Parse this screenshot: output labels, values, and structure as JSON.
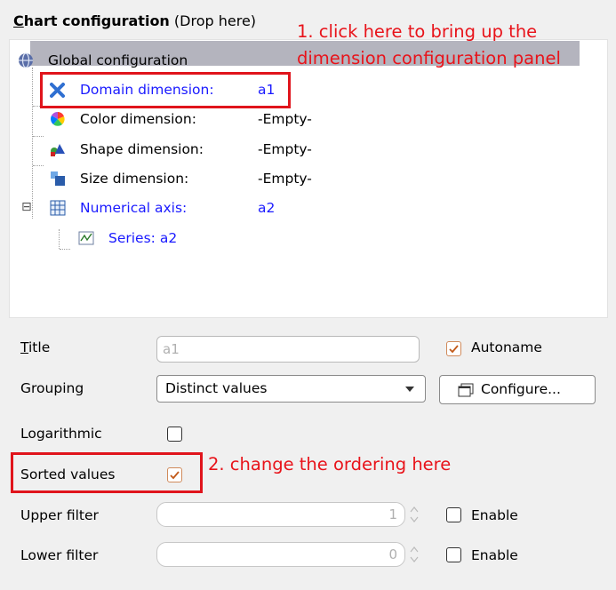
{
  "panel": {
    "title_prefix": "C",
    "title_main": "hart configuration",
    "title_suffix": " (Drop here)"
  },
  "tree": {
    "global": "Global configuration",
    "items": [
      {
        "label": "Domain dimension:",
        "value": "a1",
        "icon": "cross-axes-icon"
      },
      {
        "label": "Color dimension:",
        "value": "-Empty-",
        "icon": "color-wheel-icon"
      },
      {
        "label": "Shape dimension:",
        "value": "-Empty-",
        "icon": "shapes-icon"
      },
      {
        "label": "Size dimension:",
        "value": "-Empty-",
        "icon": "size-squares-icon"
      },
      {
        "label": "Numerical axis:",
        "value": "a2",
        "icon": "grid-axis-icon"
      }
    ],
    "series": "Series: a2",
    "expander": "⊟"
  },
  "annotations": {
    "one_line1": "1. click here to bring up the",
    "one_line2": "dimension configuration panel",
    "two": "2. change the ordering here"
  },
  "form": {
    "title_label": "Title",
    "title_underline": "T",
    "title_rest": "itle",
    "title_value": "a1",
    "autoname_label": "Autoname",
    "autoname_checked": true,
    "grouping_label": "Grouping",
    "grouping_value": "Distinct values",
    "configure_label": "Configure...",
    "logarithmic_label": "Logarithmic",
    "logarithmic_checked": false,
    "sorted_label": "Sorted values",
    "sorted_checked": true,
    "upper_label": "Upper filter",
    "upper_value": "1",
    "upper_enable": "Enable",
    "lower_label": "Lower filter",
    "lower_value": "0",
    "lower_enable": "Enable"
  },
  "colors": {
    "annotation": "#e8131a",
    "link": "#1a1aff",
    "selection": "#b4b4be"
  }
}
